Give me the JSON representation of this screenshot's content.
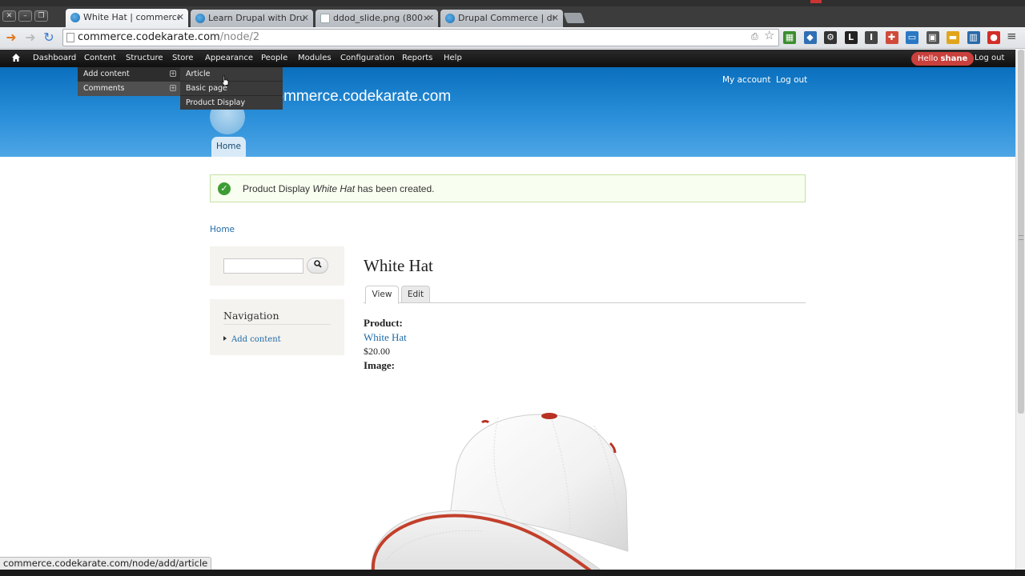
{
  "browser": {
    "tabs": [
      {
        "title": "White Hat | commerce.co",
        "active": true,
        "favicon": "drupal-icon"
      },
      {
        "title": "Learn Drupal with Drupal",
        "active": false,
        "favicon": "drupal-icon"
      },
      {
        "title": "ddod_slide.png (800×500",
        "active": false,
        "favicon": "image-icon"
      },
      {
        "title": "Drupal Commerce | drupa",
        "active": false,
        "favicon": "drupal-icon"
      }
    ],
    "url": {
      "host": "commerce.codekarate.com",
      "path": "/node/2"
    },
    "extensions": [
      {
        "name": "green-grid-extension",
        "color": "#3c8d2f",
        "glyph": "▦"
      },
      {
        "name": "blue-bookmark-extension",
        "color": "#2f6fb3",
        "glyph": "◆"
      },
      {
        "name": "gear-extension",
        "color": "#333333",
        "glyph": "⚙"
      },
      {
        "name": "l-extension",
        "color": "#222222",
        "glyph": "L"
      },
      {
        "name": "i-extension",
        "color": "#444444",
        "glyph": "I"
      },
      {
        "name": "red-plus-extension",
        "color": "#d04a3a",
        "glyph": "✚"
      },
      {
        "name": "screen-extension",
        "color": "#2a78c4",
        "glyph": "▭"
      },
      {
        "name": "dark-square-extension",
        "color": "#555555",
        "glyph": "▣"
      },
      {
        "name": "yellow-card-extension",
        "color": "#e0a51b",
        "glyph": "▬"
      },
      {
        "name": "trello-extension",
        "color": "#2a6aa8",
        "glyph": "▥"
      },
      {
        "name": "lastpass-extension",
        "color": "#d32d27",
        "glyph": "●"
      }
    ]
  },
  "admin_toolbar": {
    "items": [
      "Dashboard",
      "Content",
      "Structure",
      "Store",
      "Appearance",
      "People",
      "Modules",
      "Configuration",
      "Reports",
      "Help"
    ],
    "hello_prefix": "Hello ",
    "user": "shane",
    "logout": "Log out"
  },
  "dropdown": {
    "level1": [
      "Add content",
      "Comments"
    ],
    "level2": [
      "Article",
      "Basic page",
      "Product Display"
    ]
  },
  "header": {
    "site_name": "commerce.codekarate.com",
    "links": [
      "My account",
      "Log out"
    ],
    "home_tab": "Home"
  },
  "message": {
    "prefix": "Product Display ",
    "emphasis": "White Hat",
    "suffix": " has been created."
  },
  "breadcrumb": "Home",
  "sidebar": {
    "search_placeholder": "",
    "nav_title": "Navigation",
    "nav_link": "Add content"
  },
  "content": {
    "title": "White Hat",
    "tabs": [
      "View",
      "Edit"
    ],
    "product_label": "Product:",
    "product_link": "White Hat",
    "price": "$20.00",
    "image_label": "Image:"
  },
  "status_url": "commerce.codekarate.com/node/add/article",
  "colors": {
    "header_blue": "#2a8fd9",
    "link": "#1e6aa6",
    "success": "#3f9c35",
    "hello_badge": "#c9403c"
  }
}
